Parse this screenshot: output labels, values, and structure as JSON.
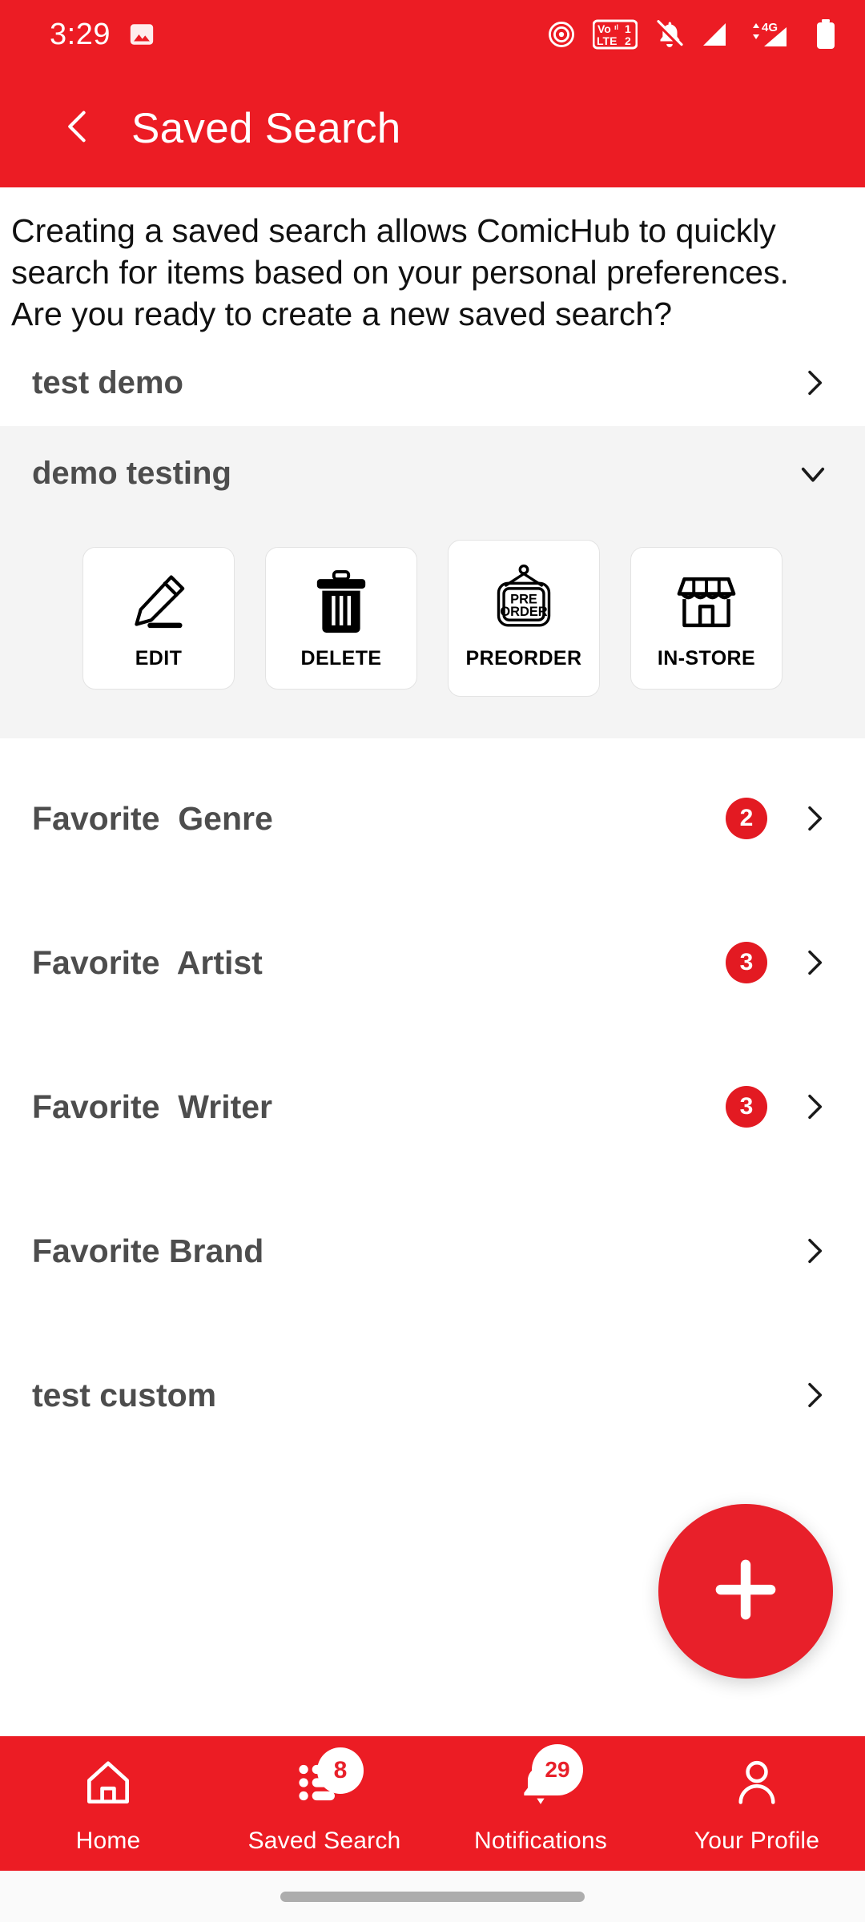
{
  "status_bar": {
    "time": "3:29",
    "icons": [
      "image-icon",
      "hotspot-icon",
      "volte-dual-sim-icon",
      "notifications-muted-icon",
      "signal-bars-icon",
      "data-4g-icon",
      "signal-bars-2-icon",
      "battery-icon"
    ],
    "volte_line1": "Vo 1",
    "volte_line2": "LTE 2",
    "network_type": "4G"
  },
  "app_bar": {
    "back_icon": "chevron-left-icon",
    "title": "Saved Search"
  },
  "intro": {
    "text": "Creating a saved search allows ComicHub to quickly search for items based on your personal preferences. Are you ready to create a new saved search?"
  },
  "saved_searches": [
    {
      "name": "test demo",
      "expanded": false,
      "chevron": "chevron-right-icon"
    },
    {
      "name": "demo testing",
      "expanded": true,
      "chevron": "chevron-down-icon"
    }
  ],
  "actions": [
    {
      "label": "EDIT",
      "icon": "pencil-icon"
    },
    {
      "label": "DELETE",
      "icon": "trash-icon"
    },
    {
      "label": "PREORDER",
      "icon": "preorder-sign-icon",
      "sign_line1": "PRE",
      "sign_line2": "ORDER"
    },
    {
      "label": "IN-STORE",
      "icon": "storefront-icon"
    }
  ],
  "preferences": [
    {
      "label": "Favorite  Genre",
      "badge": "2",
      "chevron": "chevron-right-icon"
    },
    {
      "label": "Favorite  Artist",
      "badge": "3",
      "chevron": "chevron-right-icon"
    },
    {
      "label": "Favorite  Writer",
      "badge": "3",
      "chevron": "chevron-right-icon"
    },
    {
      "label": "Favorite Brand",
      "badge": "",
      "chevron": "chevron-right-icon"
    },
    {
      "label": "test custom",
      "badge": "",
      "chevron": "chevron-right-icon"
    }
  ],
  "fab": {
    "icon": "plus-icon",
    "label": "Add saved search"
  },
  "bottom_nav": [
    {
      "label": "Home",
      "icon": "home-icon",
      "badge": ""
    },
    {
      "label": "Saved Search",
      "icon": "list-icon",
      "badge": "8",
      "active": true
    },
    {
      "label": "Notifications",
      "icon": "bell-icon",
      "badge": "29"
    },
    {
      "label": "Your Profile",
      "icon": "person-icon",
      "badge": ""
    }
  ],
  "colors": {
    "brand_red": "#EC1C24",
    "badge_red": "#E31A22",
    "group_gray": "#F4F4F4",
    "label_gray": "#4D4D4D",
    "gesture_gray": "#ADADAD"
  }
}
